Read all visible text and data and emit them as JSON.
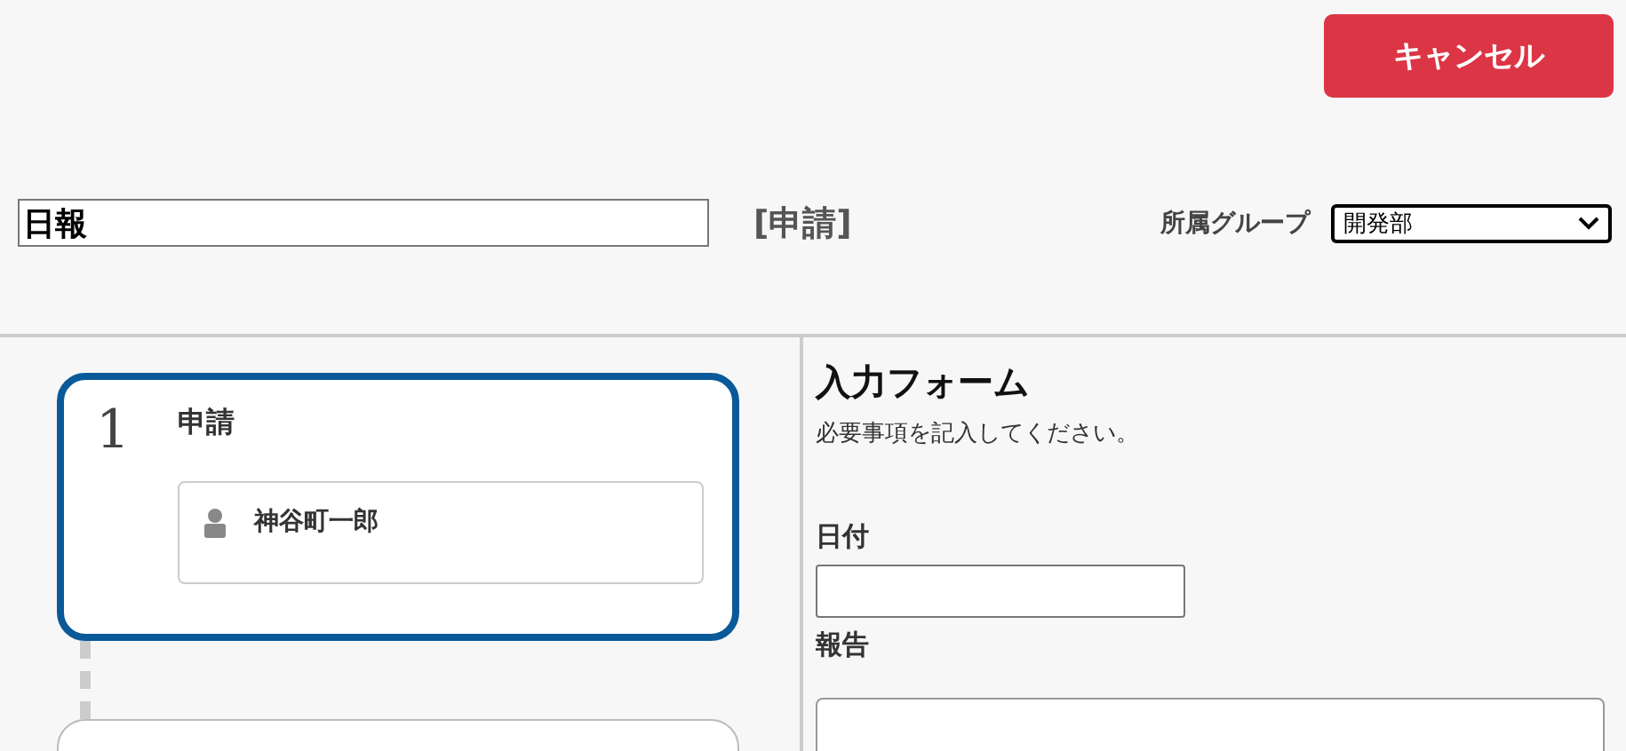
{
  "header": {
    "cancel_button": "キャンセル",
    "title_field": {
      "value": "日報"
    },
    "status": "[申請]",
    "group_label": "所属グループ",
    "group_select": {
      "value": "開発部"
    }
  },
  "steps": [
    {
      "number": "1",
      "name": "申請",
      "selected": true,
      "assignees": [
        "神谷町一郎"
      ]
    },
    {
      "selected": false
    }
  ],
  "form": {
    "title": "入力フォーム",
    "description": "必要事項を記入してください。",
    "fields": [
      {
        "label": "日付",
        "kind": "text"
      },
      {
        "label": "報告",
        "kind": "textarea"
      }
    ]
  }
}
